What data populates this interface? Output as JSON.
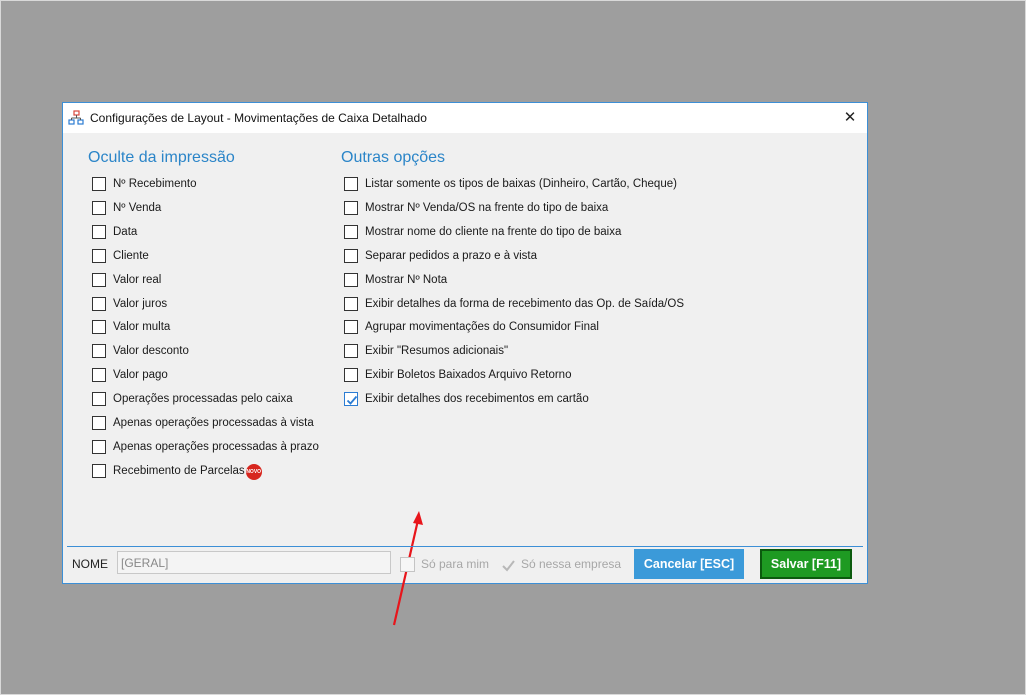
{
  "dialog": {
    "title": "Configurações de Layout - Movimentações de Caixa Detalhado",
    "close_symbol": "✕",
    "icon": "layout-tree-icon"
  },
  "left_section": {
    "title": "Oculte da impressão",
    "options": [
      {
        "label": "Nº Recebimento",
        "checked": false
      },
      {
        "label": "Nº Venda",
        "checked": false
      },
      {
        "label": "Data",
        "checked": false
      },
      {
        "label": "Cliente",
        "checked": false
      },
      {
        "label": "Valor real",
        "checked": false
      },
      {
        "label": "Valor juros",
        "checked": false
      },
      {
        "label": "Valor multa",
        "checked": false
      },
      {
        "label": "Valor desconto",
        "checked": false
      },
      {
        "label": "Valor pago",
        "checked": false
      },
      {
        "label": "Operações processadas pelo caixa",
        "checked": false
      },
      {
        "label": "Apenas operações processadas à vista",
        "checked": false
      },
      {
        "label": "Apenas operações processadas à prazo",
        "checked": false
      },
      {
        "label": "Recebimento de Parcelas",
        "checked": false
      }
    ],
    "new_badge": "NOVO"
  },
  "right_section": {
    "title": "Outras opções",
    "options": [
      {
        "label": "Listar somente os tipos de baixas (Dinheiro, Cartão, Cheque)",
        "checked": false
      },
      {
        "label": "Mostrar Nº Venda/OS na frente do tipo de baixa",
        "checked": false
      },
      {
        "label": "Mostrar nome do cliente na frente do tipo de baixa",
        "checked": false
      },
      {
        "label": "Separar pedidos a prazo e à vista",
        "checked": false
      },
      {
        "label": "Mostrar Nº Nota",
        "checked": false
      },
      {
        "label": "Exibir detalhes da forma de recebimento das Op. de Saída/OS",
        "checked": false
      },
      {
        "label": "Agrupar movimentações do Consumidor Final",
        "checked": false
      },
      {
        "label": "Exibir \"Resumos adicionais\"",
        "checked": false
      },
      {
        "label": "Exibir Boletos Baixados Arquivo Retorno",
        "checked": false
      },
      {
        "label": "Exibir detalhes dos recebimentos em cartão",
        "checked": true
      }
    ]
  },
  "footer": {
    "name_label": "NOME",
    "name_value": "[GERAL]",
    "only_me_label": "Só para mim",
    "only_me_checked": false,
    "only_company_label": "Só nessa empresa",
    "only_company_checked": true,
    "cancel_label": "Cancelar [ESC]",
    "save_label": "Salvar [F11]"
  },
  "colors": {
    "accent": "#2b85c8",
    "cancel_bg": "#3b9ad9",
    "save_bg": "#1e9a22",
    "arrow": "#e8151b"
  }
}
